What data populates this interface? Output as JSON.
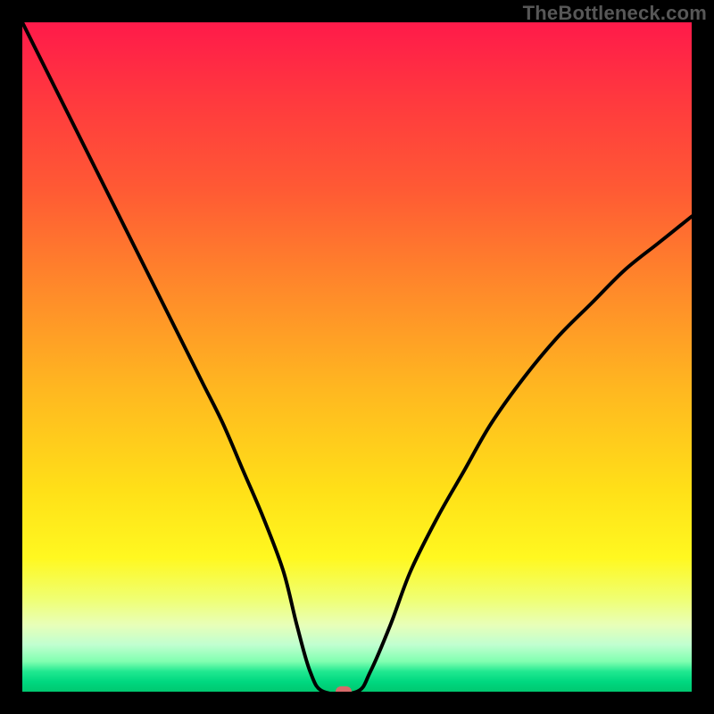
{
  "watermark": "TheBottleneck.com",
  "chart_data": {
    "type": "line",
    "title": "",
    "xlabel": "",
    "ylabel": "",
    "xlim": [
      0,
      100
    ],
    "ylim": [
      0,
      100
    ],
    "grid": false,
    "legend": false,
    "series": [
      {
        "name": "bottleneck-curve",
        "x": [
          0,
          3,
          6,
          9,
          12,
          15,
          18,
          21,
          24,
          27,
          30,
          33,
          36,
          39,
          41,
          43,
          45,
          50,
          52,
          55,
          58,
          62,
          66,
          70,
          75,
          80,
          85,
          90,
          95,
          100
        ],
        "y": [
          100,
          94,
          88,
          82,
          76,
          70,
          64,
          58,
          52,
          46,
          40,
          33,
          26,
          18,
          10,
          3,
          0,
          0,
          3,
          10,
          18,
          26,
          33,
          40,
          47,
          53,
          58,
          63,
          67,
          71
        ]
      }
    ],
    "marker": {
      "x": 48,
      "y": 0
    },
    "colors": {
      "curve": "#000000",
      "marker": "#d86a6a",
      "gradient_top": "#ff1a4a",
      "gradient_bottom": "#00c870"
    },
    "background": "#000000"
  }
}
